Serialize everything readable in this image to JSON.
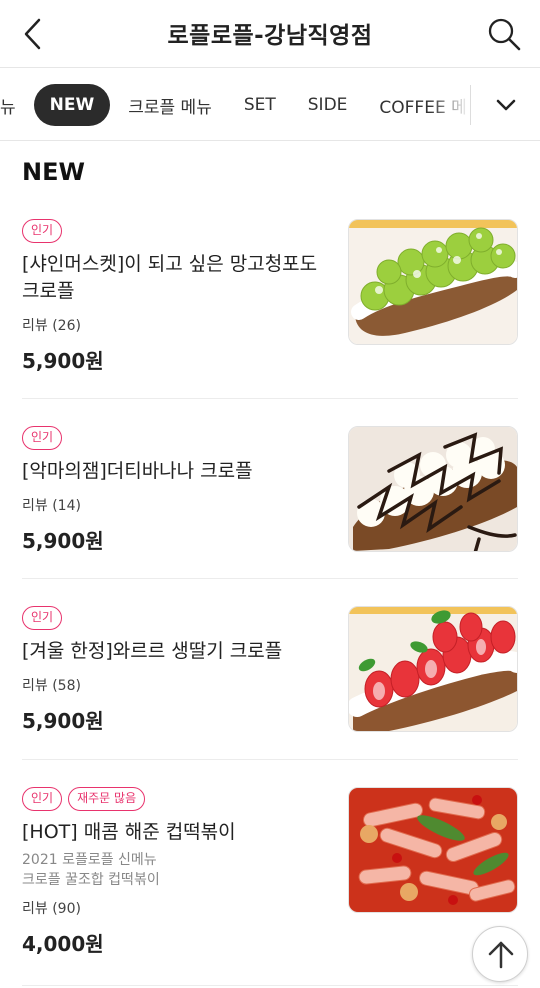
{
  "header": {
    "title": "로플로플-강남직영점"
  },
  "categories": {
    "items": [
      "뉴",
      "NEW",
      "크로플 메뉴",
      "SET",
      "SIDE",
      "COFFEE 메"
    ],
    "active_index": 1
  },
  "section": {
    "title": "NEW"
  },
  "menu": [
    {
      "badges": [
        "인기"
      ],
      "name": "[샤인머스켓]이 되고 싶은 망고청포도 크로플",
      "description": "",
      "reviews": "리뷰 (26)",
      "price": "5,900원",
      "image": "green-grape-croffle"
    },
    {
      "badges": [
        "인기"
      ],
      "name": "[악마의잼]더티바나나 크로플",
      "description": "",
      "reviews": "리뷰 (14)",
      "price": "5,900원",
      "image": "chocolate-banana-croffle"
    },
    {
      "badges": [
        "인기"
      ],
      "name": "[겨울 한정]와르르 생딸기 크로플",
      "description": "",
      "reviews": "리뷰 (58)",
      "price": "5,900원",
      "image": "strawberry-croffle"
    },
    {
      "badges": [
        "인기",
        "재주문 많음"
      ],
      "name": "[HOT] 매콤 해준 컵떡볶이",
      "description": "2021 로플로플 신메뉴\n크로플 꿀조합 컵떡볶이",
      "reviews": "리뷰 (90)",
      "price": "4,000원",
      "image": "tteokbokki"
    }
  ],
  "colors": {
    "badge": "#e8336d",
    "active_tab": "#2b2b2b"
  }
}
